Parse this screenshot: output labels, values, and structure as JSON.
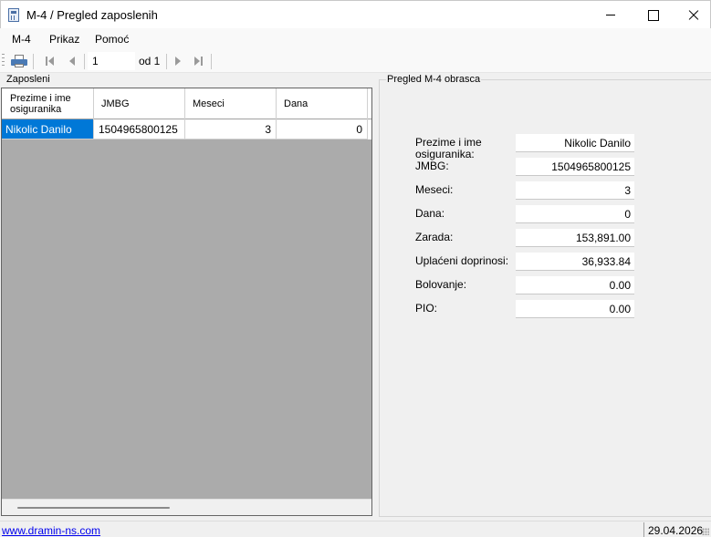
{
  "window": {
    "title": "M-4 / Pregled zaposlenih",
    "icon": "calculator-icon"
  },
  "menu": {
    "items": [
      "M-4",
      "Prikaz",
      "Pomoć"
    ]
  },
  "toolbar": {
    "current_position": "1",
    "of_label": "od 1",
    "icons": [
      "printer-icon",
      "first-record-icon",
      "previous-record-icon",
      "next-record-icon",
      "last-record-icon"
    ]
  },
  "employees": {
    "group_title": "Zaposleni",
    "columns": [
      "Prezime i ime osiguranika",
      "JMBG",
      "Meseci",
      "Dana"
    ],
    "rows": [
      {
        "name": "Nikolic Danilo",
        "jmbg": "1504965800125",
        "meseci": "3",
        "dana": "0"
      }
    ]
  },
  "preview": {
    "group_title": "Pregled M-4 obrasca",
    "fields": [
      {
        "label": "Prezime i ime osiguranika:",
        "value": "Nikolic Danilo"
      },
      {
        "label": "JMBG:",
        "value": "1504965800125"
      },
      {
        "label": "Meseci:",
        "value": "3"
      },
      {
        "label": "Dana:",
        "value": "0"
      },
      {
        "label": "Zarada:",
        "value": "153,891.00"
      },
      {
        "label": "Uplaćeni doprinosi:",
        "value": "36,933.84"
      },
      {
        "label": "Bolovanje:",
        "value": "0.00"
      },
      {
        "label": "PIO:",
        "value": "0.00"
      }
    ]
  },
  "status": {
    "link": "www.dramin-ns.com",
    "date": "29.04.2026"
  },
  "colors": {
    "selection": "#0078d7",
    "grid_background": "#ababab",
    "link": "#0000ee"
  }
}
